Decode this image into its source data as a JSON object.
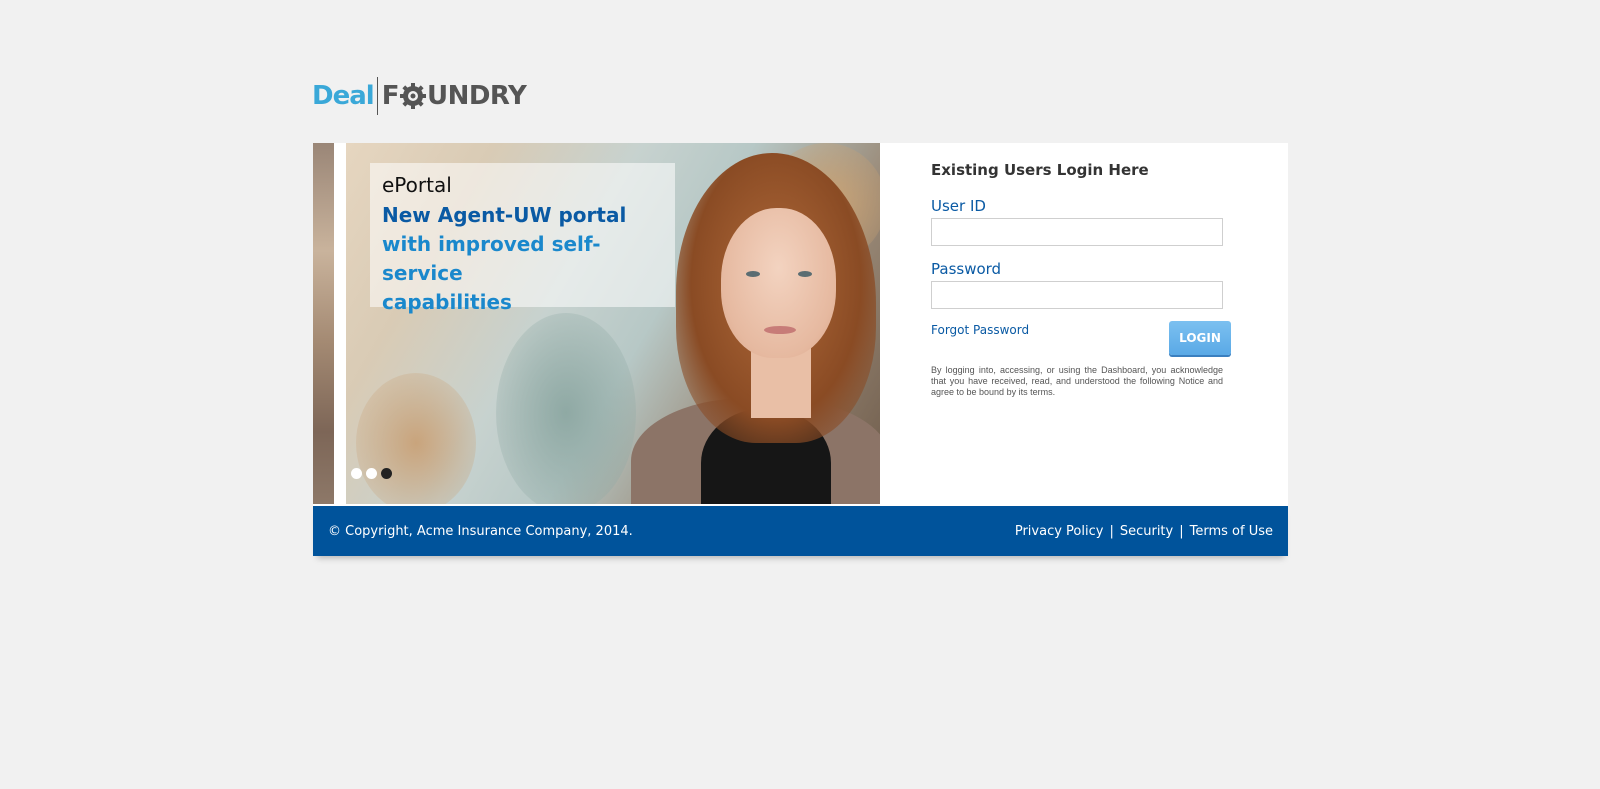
{
  "logo": {
    "part1": "Deal",
    "part2_prefix": "F",
    "part2_suffix": "UNDRY"
  },
  "slider": {
    "caption": {
      "title": "ePortal",
      "line1": "New Agent-UW portal",
      "line2": "with improved self-service",
      "line3": "capabilities"
    },
    "dots": [
      {
        "active": false
      },
      {
        "active": false
      },
      {
        "active": true
      }
    ]
  },
  "login": {
    "heading": "Existing Users Login Here",
    "user_id_label": "User ID",
    "user_id_value": "",
    "password_label": "Password",
    "password_value": "",
    "forgot_label": "Forgot Password",
    "button_label": "LOGIN",
    "notice": "By logging into, accessing, or using the Dashboard, you acknowledge that you have received, read, and understood the following Notice and agree to be bound by its terms."
  },
  "footer": {
    "copyright": "© Copyright, Acme Insurance Company, 2014.",
    "links": [
      "Privacy Policy",
      "Security",
      "Terms of Use"
    ],
    "separator": "|"
  },
  "colors": {
    "brand_blue": "#00539b",
    "logo_blue": "#3aa8d8",
    "button": "#5aa9e6",
    "background": "#f1f1f1"
  }
}
